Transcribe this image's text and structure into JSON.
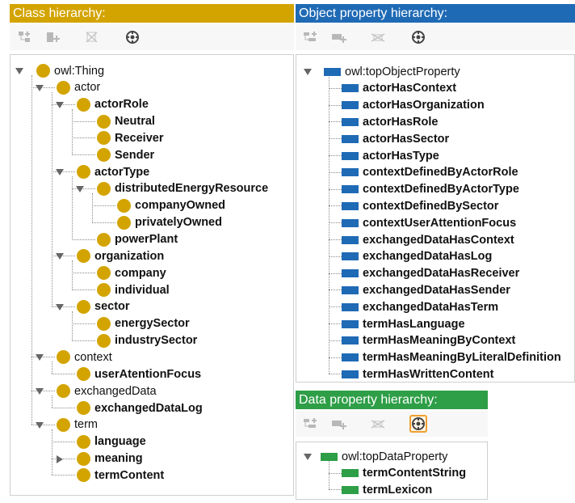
{
  "colors": {
    "class_header": "#d3a400",
    "object_header": "#1f6ab5",
    "data_header": "#2e9e47",
    "class_icon": "#d3a400",
    "object_icon": "#1f6ab5",
    "data_icon": "#2e9e47",
    "selected_border": "#f0a030"
  },
  "class_panel": {
    "title": "Class hierarchy:",
    "toolbar": [
      {
        "icon": "add-subclass-icon",
        "enabled": false
      },
      {
        "icon": "add-sibling-class-icon",
        "enabled": false
      },
      {
        "icon": "delete-class-icon",
        "enabled": false
      },
      {
        "icon": "find-usage-icon",
        "enabled": true
      }
    ],
    "tree": [
      {
        "label": "owl:Thing",
        "bold": false,
        "toggle": "expanded"
      },
      {
        "label": "actor",
        "bold": false,
        "toggle": "expanded"
      },
      {
        "label": "actorRole",
        "bold": true,
        "toggle": "expanded"
      },
      {
        "label": "Neutral",
        "bold": true,
        "toggle": "none"
      },
      {
        "label": "Receiver",
        "bold": true,
        "toggle": "none"
      },
      {
        "label": "Sender",
        "bold": true,
        "toggle": "none"
      },
      {
        "label": "actorType",
        "bold": true,
        "toggle": "expanded"
      },
      {
        "label": "distributedEnergyResource",
        "bold": true,
        "toggle": "expanded"
      },
      {
        "label": "companyOwned",
        "bold": true,
        "toggle": "none"
      },
      {
        "label": "privatelyOwned",
        "bold": true,
        "toggle": "none"
      },
      {
        "label": "powerPlant",
        "bold": true,
        "toggle": "none"
      },
      {
        "label": "organization",
        "bold": true,
        "toggle": "expanded"
      },
      {
        "label": "company",
        "bold": true,
        "toggle": "none"
      },
      {
        "label": "individual",
        "bold": true,
        "toggle": "none"
      },
      {
        "label": "sector",
        "bold": true,
        "toggle": "expanded"
      },
      {
        "label": "energySector",
        "bold": true,
        "toggle": "none"
      },
      {
        "label": "industrySector",
        "bold": true,
        "toggle": "none"
      },
      {
        "label": "context",
        "bold": false,
        "toggle": "expanded"
      },
      {
        "label": "userAtentionFocus",
        "bold": true,
        "toggle": "none"
      },
      {
        "label": "exchangedData",
        "bold": false,
        "toggle": "expanded"
      },
      {
        "label": "exchangedDataLog",
        "bold": true,
        "toggle": "none"
      },
      {
        "label": "term",
        "bold": false,
        "toggle": "expanded"
      },
      {
        "label": "language",
        "bold": true,
        "toggle": "none"
      },
      {
        "label": "meaning",
        "bold": true,
        "toggle": "collapsed"
      },
      {
        "label": "termContent",
        "bold": true,
        "toggle": "none"
      }
    ]
  },
  "object_panel": {
    "title": "Object property hierarchy:",
    "toolbar": [
      {
        "icon": "add-subproperty-icon",
        "enabled": false
      },
      {
        "icon": "add-sibling-property-icon",
        "enabled": false
      },
      {
        "icon": "delete-property-icon",
        "enabled": false
      },
      {
        "icon": "find-usage-icon",
        "enabled": true
      }
    ],
    "tree": [
      {
        "label": "owl:topObjectProperty",
        "bold": false,
        "toggle": "expanded"
      },
      {
        "label": "actorHasContext",
        "bold": true
      },
      {
        "label": "actorHasOrganization",
        "bold": true
      },
      {
        "label": "actorHasRole",
        "bold": true
      },
      {
        "label": "actorHasSector",
        "bold": true
      },
      {
        "label": "actorHasType",
        "bold": true
      },
      {
        "label": "contextDefinedByActorRole",
        "bold": true
      },
      {
        "label": "contextDefinedByActorType",
        "bold": true
      },
      {
        "label": "contextDefinedBySector",
        "bold": true
      },
      {
        "label": "contextUserAttentionFocus",
        "bold": true
      },
      {
        "label": "exchangedDataHasContext",
        "bold": true
      },
      {
        "label": "exchangedDataHasLog",
        "bold": true
      },
      {
        "label": "exchangedDataHasReceiver",
        "bold": true
      },
      {
        "label": "exchangedDataHasSender",
        "bold": true
      },
      {
        "label": "exchangedDataHasTerm",
        "bold": true
      },
      {
        "label": "termHasLanguage",
        "bold": true
      },
      {
        "label": "termHasMeaningByContext",
        "bold": true
      },
      {
        "label": "termHasMeaningByLiteralDefinition",
        "bold": true
      },
      {
        "label": "termHasWrittenContent",
        "bold": true
      }
    ]
  },
  "data_panel": {
    "title": "Data property hierarchy:",
    "toolbar": [
      {
        "icon": "add-subproperty-icon",
        "enabled": false
      },
      {
        "icon": "add-sibling-property-icon",
        "enabled": false
      },
      {
        "icon": "delete-property-icon",
        "enabled": false
      },
      {
        "icon": "find-usage-icon",
        "enabled": true,
        "selected": true
      }
    ],
    "tree": [
      {
        "label": "owl:topDataProperty",
        "bold": false,
        "toggle": "expanded"
      },
      {
        "label": "termContentString",
        "bold": true
      },
      {
        "label": "termLexicon",
        "bold": true
      }
    ]
  }
}
